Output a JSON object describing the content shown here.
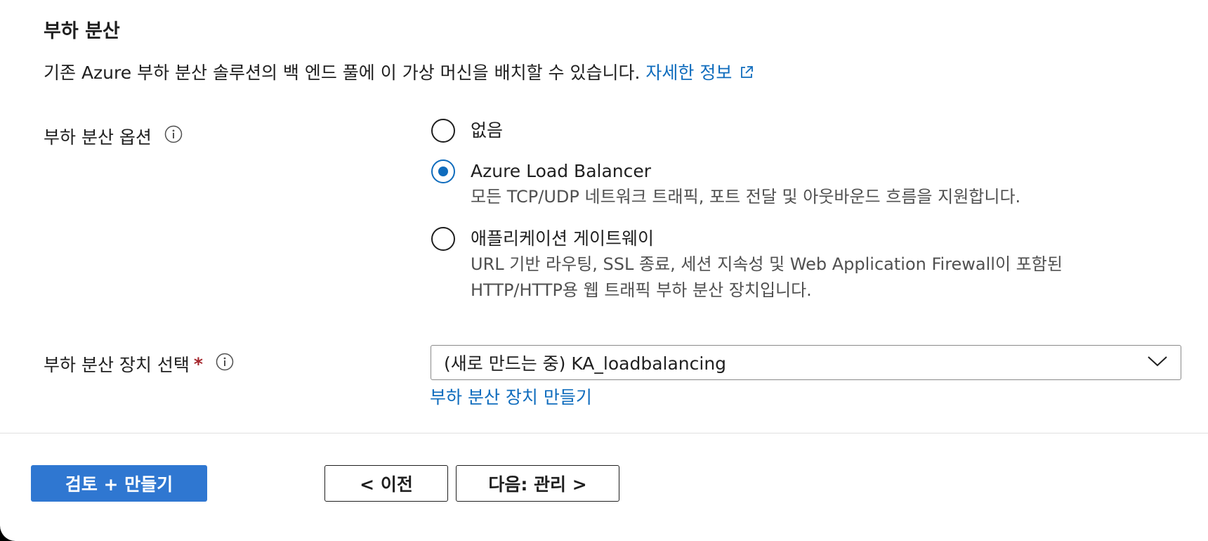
{
  "section": {
    "title": "부하 분산",
    "description": "기존 Azure 부하 분산 솔루션의 백 엔드 풀에 이 가상 머신을 배치할 수 있습니다.",
    "learn_more": "자세한 정보"
  },
  "load_balancing_options": {
    "label": "부하 분산 옵션",
    "options": [
      {
        "label": "없음",
        "description": [],
        "selected": false
      },
      {
        "label": "Azure Load Balancer",
        "description": [
          "모든 TCP/UDP 네트워크 트래픽, 포트 전달 및 아웃바운드 흐름을 지원합니다."
        ],
        "selected": true
      },
      {
        "label": "애플리케이션 게이트웨이",
        "description": [
          "URL 기반 라우팅, SSL 종료, 세션 지속성 및 Web Application Firewall이 포함된",
          "HTTP/HTTP용 웹 트래픽 부하 분산 장치입니다."
        ],
        "selected": false
      }
    ]
  },
  "load_balancer_select": {
    "label": "부하 분산 장치 선택",
    "required_mark": "*",
    "value": "(새로 만드는 중) KA_loadbalancing",
    "create_link": "부하 분산 장치 만들기"
  },
  "footer": {
    "review_create": "검토 + 만들기",
    "previous": "< 이전",
    "next": "다음: 관리 >"
  },
  "colors": {
    "link": "#0f6cbd",
    "primary_button": "#2f77d1",
    "required": "#a4262c"
  },
  "icons": {
    "external_link": "external-link-icon",
    "info": "info-icon",
    "dropdown": "chevron-down-icon"
  }
}
